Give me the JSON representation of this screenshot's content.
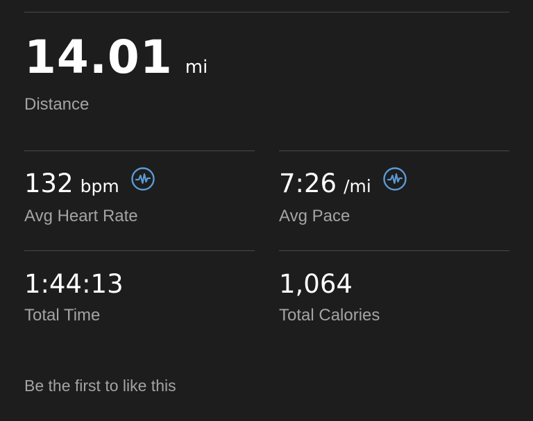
{
  "distance": {
    "value": "14.01",
    "unit": "mi",
    "label": "Distance"
  },
  "avg_heart_rate": {
    "value": "132",
    "unit": "bpm",
    "label": "Avg Heart Rate",
    "icon": "heart-rate-chart-icon"
  },
  "avg_pace": {
    "value": "7:26",
    "unit": "/mi",
    "label": "Avg Pace",
    "icon": "pace-chart-icon"
  },
  "total_time": {
    "value": "1:44:13",
    "label": "Total Time"
  },
  "total_calories": {
    "value": "1,064",
    "label": "Total Calories"
  },
  "footer": {
    "like_prompt": "Be the first to like this"
  },
  "colors": {
    "background": "#1d1d1e",
    "primary_text": "#ffffff",
    "secondary_text": "#a4a4a6",
    "divider": "#4a4a4c",
    "icon_accent": "#5b9bd5"
  }
}
